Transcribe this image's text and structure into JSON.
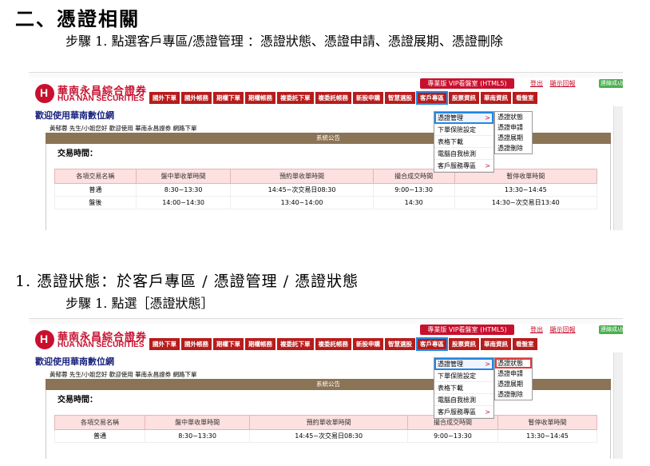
{
  "heading": "二、憑證相關",
  "step_top": "步驟 1. 點選客戶專區/憑證管理 ：憑證狀態、憑證申請、憑證展期、憑證刪除",
  "section1_title": "1. 憑證狀態：於客戶專區 / 憑證管理 / 憑證狀態",
  "section1_step": "步驟 1. 點選［憑證狀態］",
  "site": {
    "logo_zh": "華南永昌綜合證券",
    "logo_en": "HUA NAN SECURITIES",
    "vip_button": "專業版 VIP看盤室 (HTML5)",
    "top_links": [
      "登出",
      "顯示回報"
    ],
    "ok_button": "連線成功",
    "nav": [
      "國外下單",
      "國外帳務",
      "期權下單",
      "期權帳務",
      "複委託下單",
      "複委託帳務",
      "新股申購",
      "智慧選股",
      "客戶專區",
      "股票資訊",
      "華南資訊",
      "看盤室"
    ],
    "nav_selected": "客戶專區",
    "welcome": "歡迎使用華南數位網",
    "greeting": "黃郁蓉 先生/小姐您好 歡迎使用 華南永昌證券 網路下單",
    "announce": "系統公告",
    "trading_time_label": "交易時間：",
    "table_headers": [
      "各項交易名稱",
      "盤中單收單時間",
      "預約單收單時間",
      "撮合成交時間",
      "暫停收單時間"
    ],
    "rows_top": [
      [
        "普通",
        "8:30~13:30",
        "14:45~次交易日08:30",
        "9:00~13:30",
        "13:30~14:45"
      ],
      [
        "盤後",
        "14:00~14:30",
        "13:40~14:00",
        "14:30",
        "14:30~次交易日13:40"
      ]
    ],
    "rows_bottom": [
      [
        "普通",
        "8:30~13:30",
        "14:45~次交易日08:30",
        "9:00~13:30",
        "13:30~14:45"
      ]
    ],
    "menu": [
      "憑證管理",
      "下單保險設定",
      "表格下載",
      "電腦自我檢測",
      "客戶服務專區"
    ],
    "menu_arrows": [
      ">",
      "",
      "",
      "",
      ">"
    ],
    "submenu": [
      "憑證狀態",
      "憑證申請",
      "憑證展期",
      "憑證刪除"
    ]
  }
}
